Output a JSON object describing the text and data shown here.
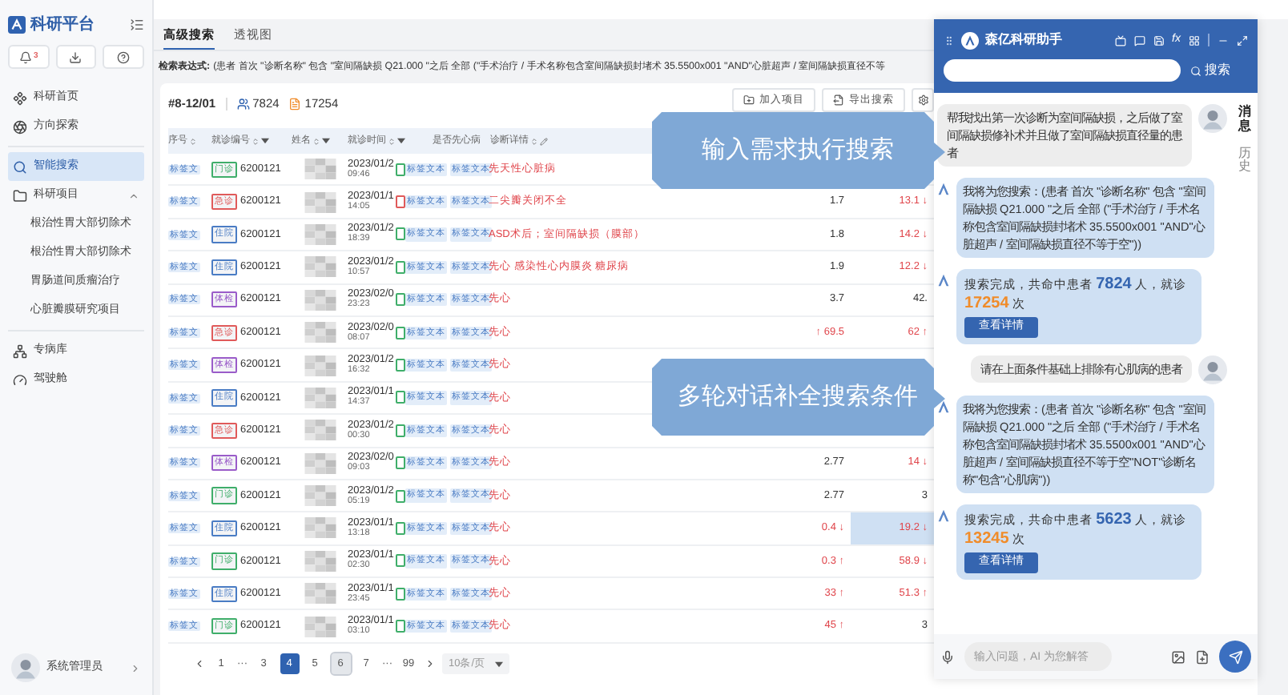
{
  "sidebar": {
    "title": "科研平台",
    "bell_badge": "3",
    "sections": [
      [
        {
          "kind": "home",
          "label": "科研首页",
          "selected": false
        },
        {
          "kind": "explore",
          "label": "方向探索",
          "selected": false
        }
      ],
      [
        {
          "kind": "search",
          "label": "智能搜索",
          "selected": true
        },
        {
          "kind": "project",
          "label": "科研项目",
          "selected": false,
          "expanded": true,
          "children": [
            {
              "label": "根治性胃大部切除术"
            },
            {
              "label": "根治性胃大部切除术"
            },
            {
              "label": "胃肠道间质瘤治疗"
            },
            {
              "label": "心脏瓣膜研究项目"
            }
          ]
        }
      ],
      [
        {
          "kind": "disease",
          "label": "专病库",
          "selected": false
        },
        {
          "kind": "cockpit",
          "label": "驾驶舱",
          "selected": false
        }
      ]
    ],
    "user": "系统管理员"
  },
  "tabs": [
    {
      "label": "高级搜索",
      "selected": true
    },
    {
      "label": "透视图",
      "selected": false
    }
  ],
  "expression": {
    "label": "检索表达式:",
    "text": "(患者 首次 \"诊断名称\" 包含 \"室间隔缺损 Q21.000 \"之后 全部 (\"手术治疗 / 手术名称包含室间隔缺损封堵术 35.5500x001 \"AND\"心脏超声 / 室间隔缺损直径不等"
  },
  "summary": {
    "range": "#8-12/01",
    "patients": "7824",
    "visits": "17254",
    "buttons": [
      "加入项目",
      "导出搜索"
    ]
  },
  "table": {
    "columns": [
      {
        "label": "序号",
        "sortable": true,
        "filter": false,
        "editable": false
      },
      {
        "label": "就诊编号",
        "sortable": true,
        "filter": true,
        "editable": false
      },
      {
        "label": "姓名",
        "sortable": true,
        "filter": true,
        "editable": false
      },
      {
        "label": "就诊时间",
        "sortable": true,
        "filter": true,
        "editable": false
      },
      {
        "label": "是否先心病",
        "sortable": false,
        "filter": false,
        "editable": false
      },
      {
        "label": "诊断详情",
        "sortable": true,
        "filter": false,
        "editable": true
      }
    ],
    "rows": [
      {
        "tag": "标签文",
        "visit": {
          "label": "门诊",
          "color": "#3fae6a"
        },
        "id": "6200121",
        "date": "2023/01/2",
        "time": "09:46",
        "flag": {
          "color": "#3fae6a"
        },
        "tags": [
          "标签文本",
          "标签文本"
        ],
        "diagnosis": "先天性心脏病"
      },
      {
        "tag": "标签文",
        "visit": {
          "label": "急诊",
          "color": "#e05a5a"
        },
        "id": "6200121",
        "date": "2023/01/1",
        "time": "14:05",
        "flag": {
          "color": "#e05a5a"
        },
        "tags": [
          "标签文本",
          "标签文本"
        ],
        "diagnosis": "二尖瓣关闭不全",
        "v1": {
          "text": "1.7",
          "alert": false
        },
        "v2": {
          "text": "13.1 ↓",
          "alert": true,
          "selected": false
        }
      },
      {
        "tag": "标签文",
        "visit": {
          "label": "住院",
          "color": "#4a7cc4"
        },
        "id": "6200121",
        "date": "2023/01/2",
        "time": "18:39",
        "flag": {
          "color": "#3fae6a"
        },
        "tags": [
          "标签文本",
          "标签文本"
        ],
        "diagnosis": "ASD术后；室间隔缺损（膜部）",
        "v1": {
          "text": "1.8",
          "alert": false
        },
        "v2": {
          "text": "14.2 ↓",
          "alert": true,
          "selected": false
        }
      },
      {
        "tag": "标签文",
        "visit": {
          "label": "住院",
          "color": "#4a7cc4"
        },
        "id": "6200121",
        "date": "2023/01/2",
        "time": "10:57",
        "flag": {
          "color": "#3fae6a"
        },
        "tags": [
          "标签文本",
          "标签文本"
        ],
        "diagnosis": "先心 感染性心内膜炎 糖尿病",
        "v1": {
          "text": "1.9",
          "alert": false
        },
        "v2": {
          "text": "12.2 ↓",
          "alert": true,
          "selected": false
        }
      },
      {
        "tag": "标签文",
        "visit": {
          "label": "体检",
          "color": "#9a5cc9"
        },
        "id": "6200121",
        "date": "2023/02/0",
        "time": "23:23",
        "flag": {
          "color": "#3fae6a"
        },
        "tags": [
          "标签文本",
          "标签文本"
        ],
        "diagnosis": "先心",
        "v1": {
          "text": "3.7",
          "alert": false
        },
        "v2": {
          "text": "42.",
          "alert": false,
          "selected": false
        }
      },
      {
        "tag": "标签文",
        "visit": {
          "label": "急诊",
          "color": "#e05a5a"
        },
        "id": "6200121",
        "date": "2023/02/0",
        "time": "08:07",
        "flag": {
          "color": "#3fae6a"
        },
        "tags": [
          "标签文本",
          "标签文本"
        ],
        "diagnosis": "先心",
        "v1": {
          "text": "↑ 69.5",
          "alert": true
        },
        "v2": {
          "text": "62 ↑",
          "alert": true,
          "selected": false
        }
      },
      {
        "tag": "标签文",
        "visit": {
          "label": "体检",
          "color": "#9a5cc9"
        },
        "id": "6200121",
        "date": "2023/01/2",
        "time": "16:32",
        "flag": {
          "color": "#3fae6a"
        },
        "tags": [
          "标签文本",
          "标签文本"
        ],
        "diagnosis": "先心"
      },
      {
        "tag": "标签文",
        "visit": {
          "label": "住院",
          "color": "#4a7cc4"
        },
        "id": "6200121",
        "date": "2023/01/1",
        "time": "14:37",
        "flag": {
          "color": "#3fae6a"
        },
        "tags": [
          "标签文本",
          "标签文本"
        ],
        "diagnosis": "先心"
      },
      {
        "tag": "标签文",
        "visit": {
          "label": "急诊",
          "color": "#e05a5a"
        },
        "id": "6200121",
        "date": "2023/01/2",
        "time": "00:30",
        "flag": {
          "color": "#3fae6a"
        },
        "tags": [
          "标签文本",
          "标签文本"
        ],
        "diagnosis": "先心"
      },
      {
        "tag": "标签文",
        "visit": {
          "label": "体检",
          "color": "#9a5cc9"
        },
        "id": "6200121",
        "date": "2023/02/0",
        "time": "09:03",
        "flag": {
          "color": "#3fae6a"
        },
        "tags": [
          "标签文本",
          "标签文本"
        ],
        "diagnosis": "先心",
        "v1": {
          "text": "2.77",
          "alert": false
        },
        "v2": {
          "text": "14 ↓",
          "alert": true,
          "selected": false
        }
      },
      {
        "tag": "标签文",
        "visit": {
          "label": "门诊",
          "color": "#3fae6a"
        },
        "id": "6200121",
        "date": "2023/01/2",
        "time": "05:19",
        "flag": {
          "color": "#3fae6a"
        },
        "tags": [
          "标签文本",
          "标签文本"
        ],
        "diagnosis": "先心",
        "v1": {
          "text": "2.77",
          "alert": false
        },
        "v2": {
          "text": "3",
          "alert": false,
          "selected": false
        }
      },
      {
        "tag": "标签文",
        "visit": {
          "label": "住院",
          "color": "#4a7cc4"
        },
        "id": "6200121",
        "date": "2023/01/1",
        "time": "13:18",
        "flag": {
          "color": "#3fae6a"
        },
        "tags": [
          "标签文本",
          "标签文本"
        ],
        "diagnosis": "先心",
        "v1": {
          "text": "0.4 ↓",
          "alert": true
        },
        "v2": {
          "text": "19.2 ↓",
          "alert": true,
          "selected": true
        }
      },
      {
        "tag": "标签文",
        "visit": {
          "label": "门诊",
          "color": "#3fae6a"
        },
        "id": "6200121",
        "date": "2023/01/1",
        "time": "02:30",
        "flag": {
          "color": "#3fae6a"
        },
        "tags": [
          "标签文本",
          "标签文本"
        ],
        "diagnosis": "先心",
        "v1": {
          "text": "0.3 ↑",
          "alert": true
        },
        "v2": {
          "text": "58.9 ↓",
          "alert": true,
          "selected": false
        }
      },
      {
        "tag": "标签文",
        "visit": {
          "label": "住院",
          "color": "#4a7cc4"
        },
        "id": "6200121",
        "date": "2023/01/1",
        "time": "23:45",
        "flag": {
          "color": "#3fae6a"
        },
        "tags": [
          "标签文本",
          "标签文本"
        ],
        "diagnosis": "先心",
        "v1": {
          "text": "33 ↑",
          "alert": true
        },
        "v2": {
          "text": "51.3 ↑",
          "alert": true,
          "selected": false
        }
      },
      {
        "tag": "标签文",
        "visit": {
          "label": "门诊",
          "color": "#3fae6a"
        },
        "id": "6200121",
        "date": "2023/01/1",
        "time": "03:10",
        "flag": {
          "color": "#3fae6a"
        },
        "tags": [
          "标签文本",
          "标签文本"
        ],
        "diagnosis": "先心",
        "v1": {
          "text": "45 ↑",
          "alert": true
        },
        "v2": {
          "text": "3",
          "alert": false,
          "selected": false
        }
      }
    ]
  },
  "pagination": {
    "pages": [
      {
        "kind": "page",
        "label": "1",
        "selected": false,
        "hovered": false
      },
      {
        "kind": "ellipsis",
        "label": "···"
      },
      {
        "kind": "page",
        "label": "3",
        "selected": false,
        "hovered": false
      },
      {
        "kind": "page",
        "label": "4",
        "selected": true,
        "hovered": false
      },
      {
        "kind": "page",
        "label": "5",
        "selected": false,
        "hovered": false
      },
      {
        "kind": "page",
        "label": "6",
        "selected": false,
        "hovered": true
      },
      {
        "kind": "page",
        "label": "7",
        "selected": false,
        "hovered": false
      },
      {
        "kind": "ellipsis",
        "label": "···"
      },
      {
        "kind": "page",
        "label": "99",
        "selected": false,
        "hovered": false
      }
    ],
    "page_size": "10条/页"
  },
  "callouts": [
    "输入需求执行搜索",
    "多轮对话补全搜索条件"
  ],
  "chat": {
    "title": "森亿科研助手",
    "fx": "fx",
    "search_button": "搜索",
    "side_tabs": [
      {
        "label": "消息",
        "selected": true
      },
      {
        "label": "历史",
        "selected": false
      }
    ],
    "messages": [
      {
        "kind": "user",
        "text": "帮我找出第一次诊断为室间隔缺损，之后做了室间隔缺损修补术并且做了室间隔缺损直径量的患者"
      },
      {
        "kind": "bot",
        "text": "我将为您搜索：(患者 首次 \"诊断名称\" 包含 \"室间隔缺损 Q21.000 \"之后 全部 (\"手术治疗 / 手术名称包含室间隔缺损封堵术 35.5500x001 \"AND\"心脏超声 / 室间隔缺损直径不等于空\"))"
      },
      {
        "kind": "result",
        "prefix": "搜索完成，共命中患者",
        "patients": "7824",
        "middle": "人，就诊",
        "visits": "17254",
        "suffix": "次",
        "button": "查看详情"
      },
      {
        "kind": "user",
        "text": "请在上面条件基础上排除有心肌病的患者"
      },
      {
        "kind": "bot",
        "text": "我将为您搜索：(患者 首次 \"诊断名称\" 包含 \"室间隔缺损 Q21.000 \"之后 全部 (\"手术治疗 / 手术名称包含室间隔缺损封堵术 35.5500x001 \"AND\"心脏超声 / 室间隔缺损直径不等于空\"NOT\"诊断名称\"包含\"心肌病\"))"
      },
      {
        "kind": "result",
        "prefix": "搜索完成，共命中患者",
        "patients": "5623",
        "middle": "人，就诊",
        "visits": "13245",
        "suffix": "次",
        "button": "查看详情"
      }
    ],
    "input_placeholder": "输入问题，AI 为您解答"
  }
}
